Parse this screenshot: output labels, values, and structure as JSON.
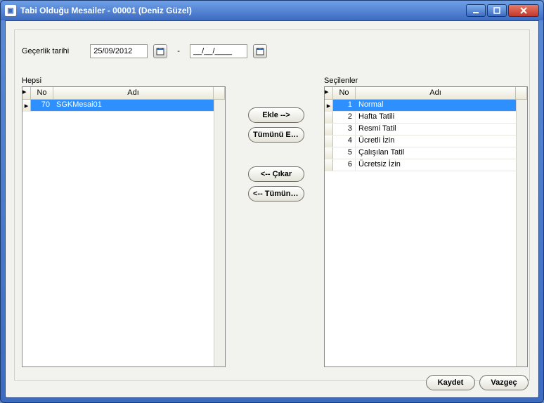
{
  "window": {
    "title": "Tabi Olduğu Mesailer - 00001 (Deniz Güzel)"
  },
  "dates": {
    "label": "Geçerlik tarihi",
    "from": "25/09/2012",
    "to": "__/__/____",
    "separator": "-"
  },
  "lists": {
    "all_label": "Hepsi",
    "selected_label": "Seçilenler",
    "col_no": "No",
    "col_name": "Adı"
  },
  "all_rows": [
    {
      "no": "70",
      "name": "SGKMesai01",
      "selected": true
    }
  ],
  "selected_rows": [
    {
      "no": "1",
      "name": "Normal",
      "selected": true
    },
    {
      "no": "2",
      "name": "Hafta Tatili"
    },
    {
      "no": "3",
      "name": "Resmi Tatil"
    },
    {
      "no": "4",
      "name": "Ücretli İzin"
    },
    {
      "no": "5",
      "name": "Çalışılan Tatil"
    },
    {
      "no": "6",
      "name": "Ücretsiz İzin"
    }
  ],
  "buttons": {
    "add": "Ekle -->",
    "add_all": "Tümünü Ekl...",
    "remove": "<-- Çıkar",
    "remove_all": "<-- Tümünü...",
    "save": "Kaydet",
    "cancel": "Vazgeç"
  }
}
